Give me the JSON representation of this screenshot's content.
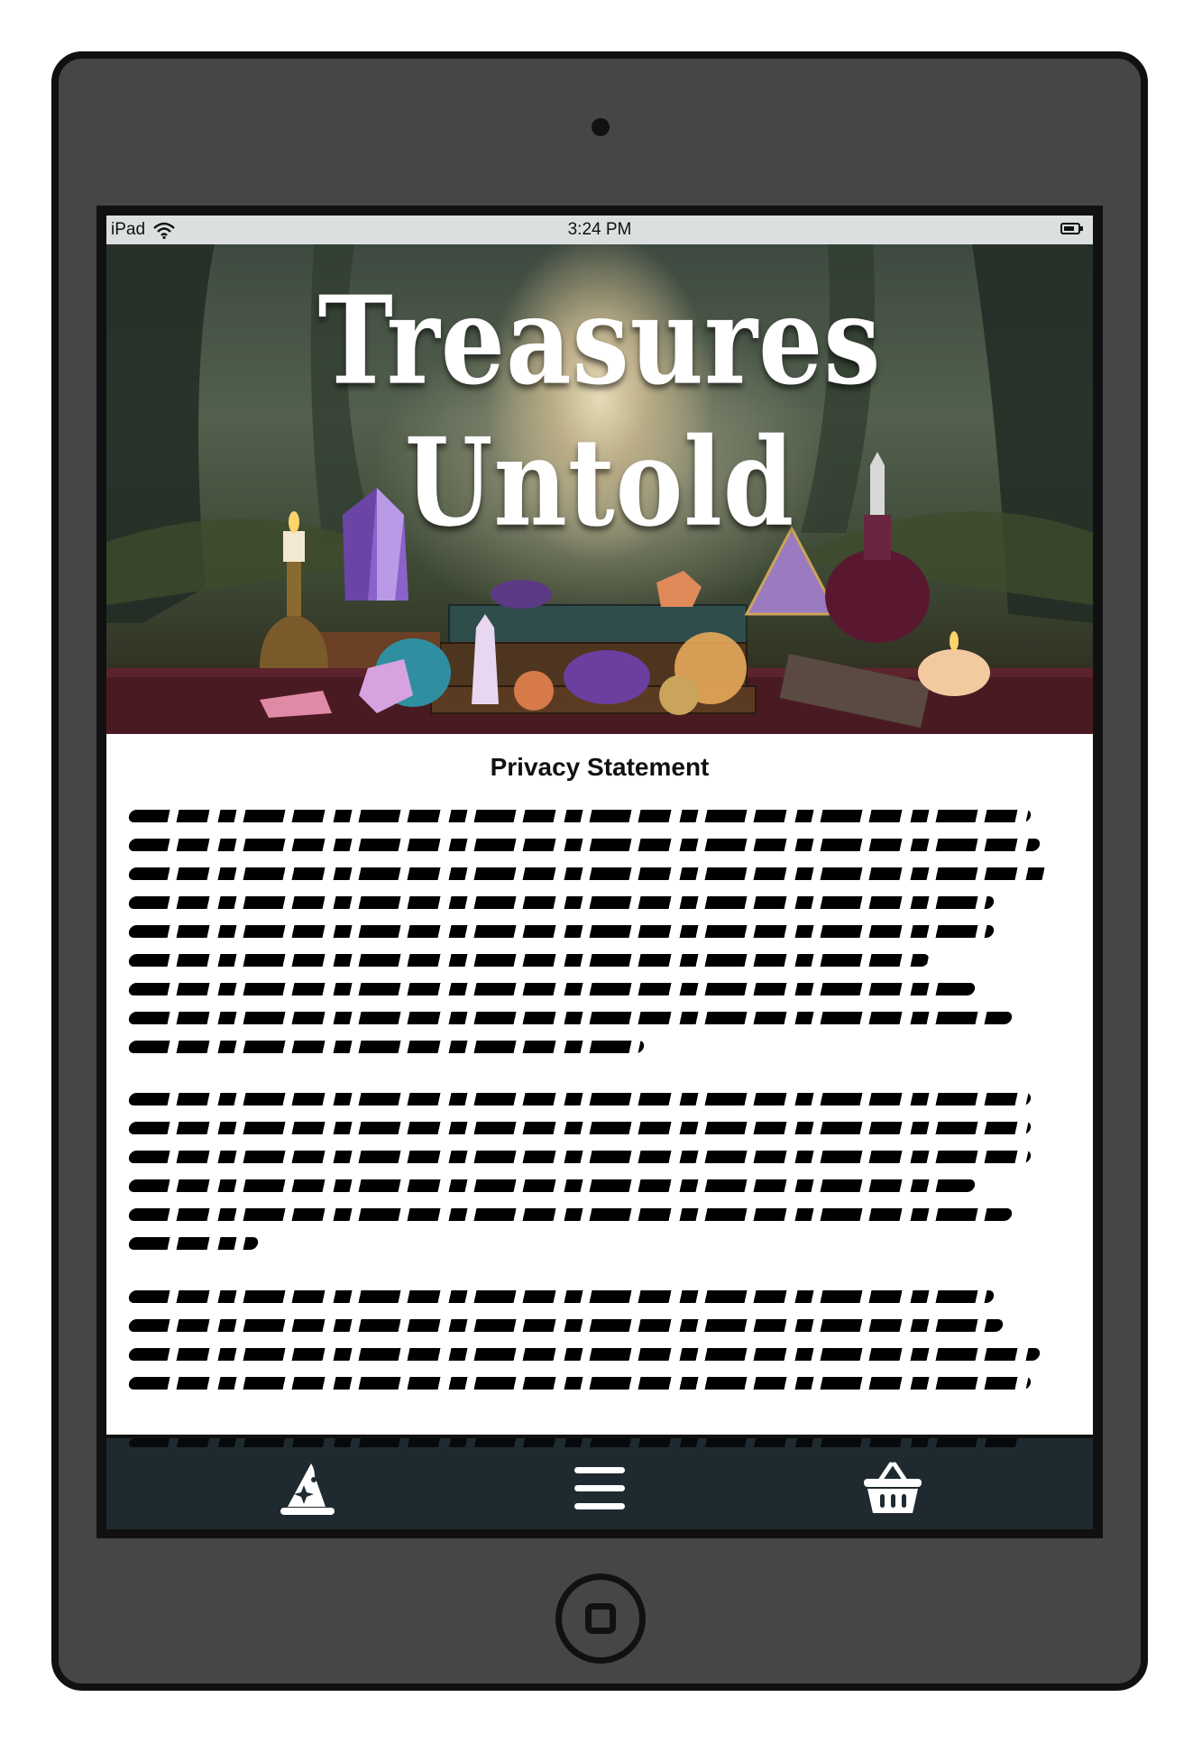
{
  "statusbar": {
    "device": "iPad",
    "time": "3:24 PM"
  },
  "hero": {
    "title": "Treasures Untold"
  },
  "main": {
    "title": "Privacy Statement",
    "paragraphs": [
      {
        "lines": [
          0.98,
          0.99,
          1.0,
          0.94,
          0.94,
          0.87,
          0.92,
          0.96,
          0.56
        ]
      },
      {
        "lines": [
          0.98,
          0.98,
          0.98,
          0.92,
          0.96,
          0.14
        ]
      },
      {
        "lines": [
          0.94,
          0.95,
          0.99,
          0.98
        ]
      }
    ]
  },
  "tabbar": {
    "items": [
      {
        "name": "wizard-hat-icon"
      },
      {
        "name": "menu-icon"
      },
      {
        "name": "basket-icon"
      }
    ]
  },
  "colors": {
    "device": "#464646",
    "tabbar": "#1f2a30",
    "statusbar": "#dcdfe0"
  }
}
